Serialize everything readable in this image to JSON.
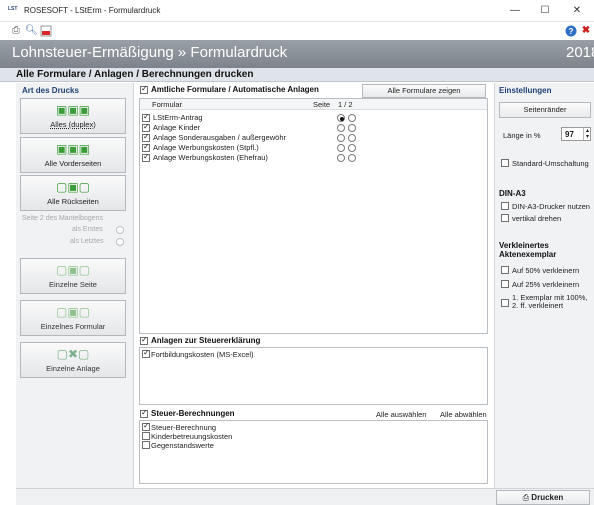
{
  "window": {
    "app_icon_text": "LST",
    "title": "ROSESOFT - LStErm - Formulardruck",
    "minimize": "—",
    "maximize": "☐",
    "close": "✕"
  },
  "banner": {
    "title": "Lohnsteuer-Ermäßigung » Formulardruck",
    "year": "2018"
  },
  "subheader": "Alle Formulare / Anlagen / Berechnungen drucken",
  "left": {
    "section_title": "Art des Drucks",
    "buttons": [
      {
        "label": "Alles (duplex)"
      },
      {
        "label": "Alle Vorderseiten"
      },
      {
        "label": "Alle Rückseiten"
      },
      {
        "label": "Einzelne Seite"
      },
      {
        "label": "Einzelnes Formular"
      },
      {
        "label": "Einzelne Anlage"
      }
    ],
    "mantel_label": "Seite 2 des Mantelbogens",
    "als_erstes": "als Erstes",
    "als_letztes": "als Letztes"
  },
  "amtliche": {
    "header": "Amtliche Formulare / Automatische Anlagen",
    "show_all_button": "Alle Formulare zeigen",
    "col_formular": "Formular",
    "col_seite": "Seite",
    "col_pages": "1 / 2",
    "rows": [
      {
        "label": "LStErm-Antrag",
        "checked": true,
        "selected": 1
      },
      {
        "label": "Anlage Kinder",
        "checked": true,
        "selected": 0
      },
      {
        "label": "Anlage Sonderausgaben / außergewöhr",
        "checked": true,
        "selected": 0
      },
      {
        "label": "Anlage Werbungskosten (Stpfl.)",
        "checked": true,
        "selected": 0
      },
      {
        "label": "Anlage Werbungskosten (Ehefrau)",
        "checked": true,
        "selected": 0
      }
    ]
  },
  "anlagen": {
    "header": "Anlagen zur Steuererklärung",
    "rows": [
      {
        "label": "Fortbildungskosten (MS-Excel)",
        "checked": true
      }
    ]
  },
  "steuer": {
    "header": "Steuer-Berechnungen",
    "select_all": "Alle auswählen",
    "deselect_all": "Alle abwählen",
    "rows": [
      {
        "label": "Steuer-Berechnung",
        "checked": true
      },
      {
        "label": "Kinderbetreuungskosten",
        "checked": false
      },
      {
        "label": "Gegenstandswerte",
        "checked": false
      }
    ]
  },
  "settings": {
    "title": "Einstellungen",
    "margins_button": "Seitenränder",
    "length_label": "Länge in %",
    "length_value": "97",
    "standard_switch": "Standard-Umschaltung",
    "dina3_title": "DIN-A3",
    "dina3_printer": "DIN-A3-Drucker nutzen",
    "vertical_rotate": "vertikal drehen",
    "reduced_title": "Verkleinertes Aktenexemplar",
    "reduce_50": "Auf 50% verkleinern",
    "reduce_25": "Auf 25% verkleinern",
    "first_copy": "1. Exemplar mit 100%, 2. ff. verkleinert"
  },
  "footer": {
    "print_button": "Drucken"
  }
}
